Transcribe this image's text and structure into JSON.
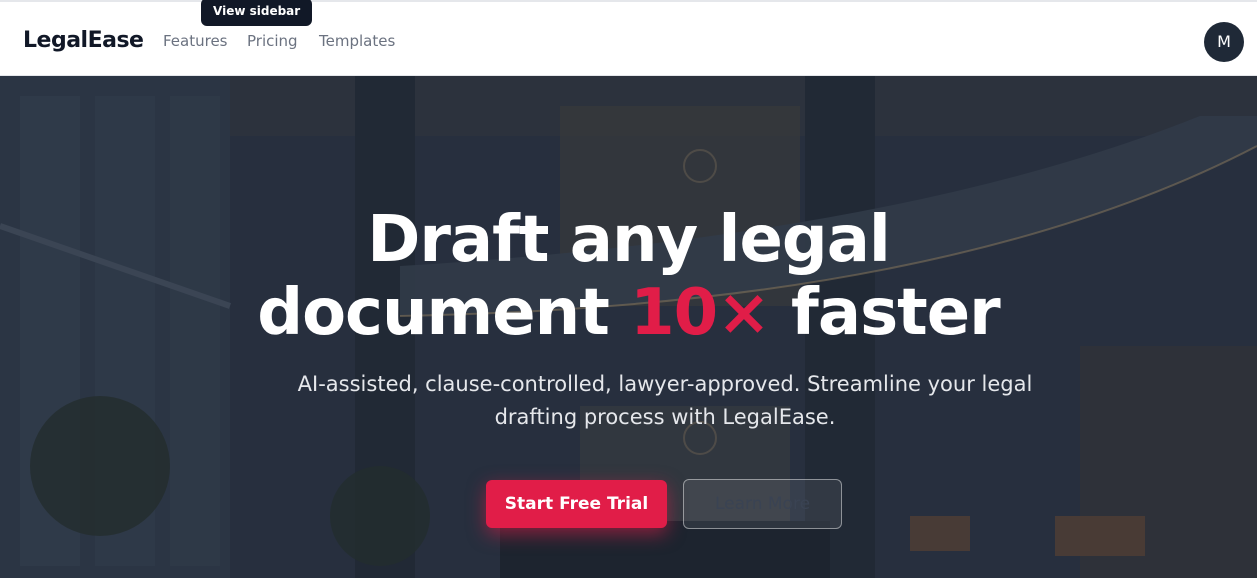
{
  "header": {
    "brand": "LegalEase",
    "nav": [
      "Features",
      "Pricing",
      "Templates"
    ],
    "tooltip": "View sidebar",
    "avatar_initial": "M"
  },
  "hero": {
    "title_line1": "Draft any legal",
    "title_line2_before": "document",
    "title_accent": "10×",
    "title_line2_after": "faster",
    "subtitle": "AI-assisted, clause-controlled, lawyer-approved. Streamline your legal drafting process with LegalEase.",
    "primary_cta": "Start Free Trial",
    "secondary_cta": "Learn More"
  },
  "colors": {
    "accent": "#e11d48",
    "header_bg": "#ffffff",
    "hero_overlay": "#2d3647",
    "text_dark": "#111827",
    "nav_text": "#6b7280"
  }
}
